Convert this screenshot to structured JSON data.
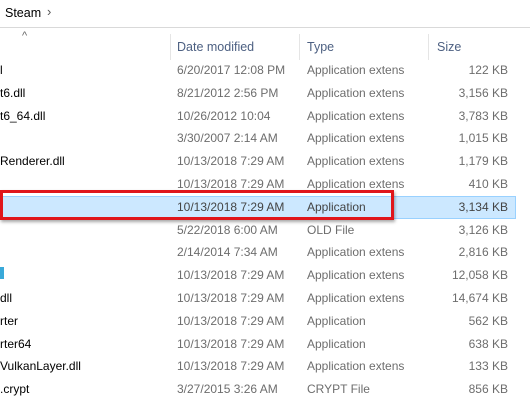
{
  "address_bar": {
    "crumb": "Steam",
    "chevron": "›"
  },
  "header": {
    "sort_arrow": "^",
    "columns": {
      "date": "Date modified",
      "type": "Type",
      "size": "Size"
    }
  },
  "rows": [
    {
      "name": "l",
      "date": "6/20/2017 12:08 PM",
      "type": "Application extens",
      "size": "122 KB"
    },
    {
      "name": "t6.dll",
      "date": "8/21/2012 2:56 PM",
      "type": "Application extens",
      "size": "3,156 KB"
    },
    {
      "name": "t6_64.dll",
      "date": "10/26/2012 10:04",
      "type": "Application extens",
      "size": "3,783 KB"
    },
    {
      "name": "",
      "date": "3/30/2007 2:14 AM",
      "type": "Application extens",
      "size": "1,015 KB"
    },
    {
      "name": "Renderer.dll",
      "date": "10/13/2018 7:29 AM",
      "type": "Application extens",
      "size": "1,179 KB"
    },
    {
      "name": "",
      "date": "10/13/2018 7:29 AM",
      "type": "Application extens",
      "size": "410 KB"
    },
    {
      "name": "",
      "date": "10/13/2018 7:29 AM",
      "type": "Application",
      "size": "3,134 KB",
      "selected": true
    },
    {
      "name": "",
      "date": "5/22/2018 6:00 AM",
      "type": "OLD File",
      "size": "3,126 KB"
    },
    {
      "name": "",
      "date": "2/14/2014 7:34 AM",
      "type": "Application extens",
      "size": "2,816 KB"
    },
    {
      "name": "",
      "date": "10/13/2018 7:29 AM",
      "type": "Application extens",
      "size": "12,058 KB",
      "icon": true
    },
    {
      "name": "dll",
      "date": "10/13/2018 7:29 AM",
      "type": "Application extens",
      "size": "14,674 KB"
    },
    {
      "name": "rter",
      "date": "10/13/2018 7:29 AM",
      "type": "Application",
      "size": "562 KB"
    },
    {
      "name": "rter64",
      "date": "10/13/2018 7:29 AM",
      "type": "Application",
      "size": "638 KB"
    },
    {
      "name": "VulkanLayer.dll",
      "date": "10/13/2018 7:29 AM",
      "type": "Application extens",
      "size": "133 KB"
    },
    {
      "name": ".crypt",
      "date": "3/27/2015 3:26 AM",
      "type": "CRYPT File",
      "size": "856 KB"
    }
  ]
}
